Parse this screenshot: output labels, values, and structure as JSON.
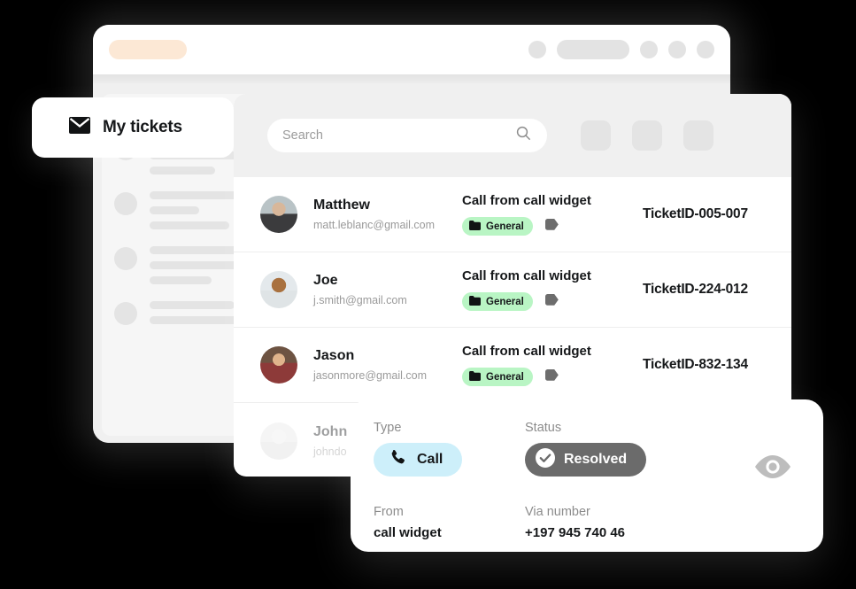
{
  "window": {
    "logo_placeholder": "logo-pill",
    "topbar_items": [
      "circle",
      "pill",
      "circle",
      "circle",
      "circle"
    ]
  },
  "skeleton": {
    "header_placeholder": "loading-bar",
    "rows": [
      {
        "lines": [
          96,
          112,
          74
        ]
      },
      {
        "lines": [
          126,
          56,
          90
        ]
      },
      {
        "lines": [
          126,
          104,
          70
        ]
      },
      {
        "lines": [
          96,
          112
        ]
      }
    ]
  },
  "tickets_card": {
    "icon": "envelope-icon",
    "label": "My tickets"
  },
  "toolbar": {
    "search_placeholder": "Search",
    "search_value": "",
    "search_icon": "search-icon",
    "filter_buttons": [
      "filter-button-1",
      "filter-button-2",
      "filter-button-3"
    ]
  },
  "tickets": [
    {
      "name": "Matthew",
      "email": "matt.leblanc@gmail.com",
      "subject": "Call from call widget",
      "tag": "General",
      "tag_icon": "folder-icon",
      "secondary_tag_icon": "tag-icon",
      "ticket_id": "TicketID-005-007",
      "avatar": "avatar-matthew"
    },
    {
      "name": "Joe",
      "email": "j.smith@gmail.com",
      "subject": "Call from call widget",
      "tag": "General",
      "tag_icon": "folder-icon",
      "secondary_tag_icon": "tag-icon",
      "ticket_id": "TicketID-224-012",
      "avatar": "avatar-joe"
    },
    {
      "name": "Jason",
      "email": "jasonmore@gmail.com",
      "subject": "Call from call widget",
      "tag": "General",
      "tag_icon": "folder-icon",
      "secondary_tag_icon": "tag-icon",
      "ticket_id": "TicketID-832-134",
      "avatar": "avatar-jason"
    },
    {
      "name": "John D",
      "email": "johndo",
      "subject": "",
      "tag": "",
      "tag_icon": "",
      "secondary_tag_icon": "",
      "ticket_id": "",
      "avatar": "avatar-john"
    }
  ],
  "detail": {
    "type_label": "Type",
    "type_value": "Call",
    "type_icon": "phone-icon",
    "status_label": "Status",
    "status_value": "Resolved",
    "status_icon": "check-circle-icon",
    "from_label": "From",
    "from_value": "call widget",
    "via_label": "Via number",
    "via_value": "+197 945 740 46",
    "preview_icon": "eye-icon"
  },
  "colors": {
    "background": "#000000",
    "card": "#ffffff",
    "panel": "#f0f0f0",
    "accent_peach": "#fce8d5",
    "tag_green": "#b9f5c4",
    "pill_cyan": "#cdeffa",
    "pill_gray": "#6b6b6b",
    "muted_text": "#9a9a9a",
    "skeleton": "#e4e4e4"
  }
}
